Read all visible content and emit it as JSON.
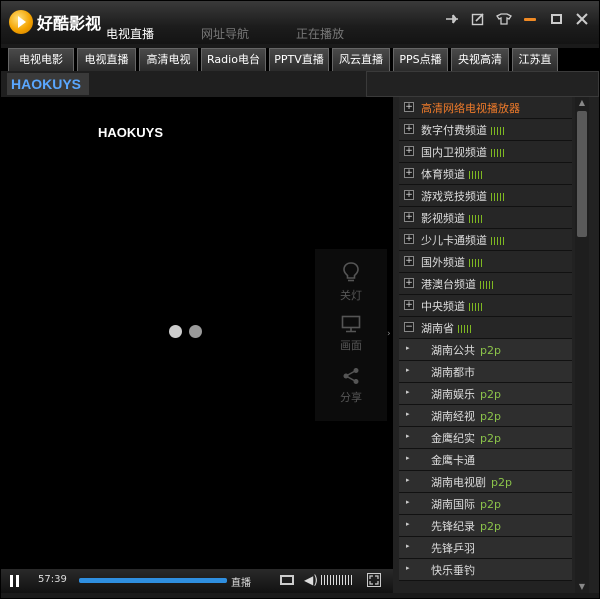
{
  "app": {
    "name": "好酷影视"
  },
  "top_nav": [
    {
      "label": "电视直播",
      "active": true
    },
    {
      "label": "网址导航",
      "active": false
    },
    {
      "label": "正在播放",
      "active": false
    }
  ],
  "tabs": [
    "电视电影",
    "电视直播",
    "高清电视",
    "Radio电台",
    "PPTV直播",
    "风云直播",
    "PPS点播",
    "央视高清",
    "江苏直"
  ],
  "brand": "HAOKUYS",
  "video_overlay_brand": "HAOKUYS",
  "tools": [
    {
      "icon": "bulb-icon",
      "label": "关灯"
    },
    {
      "icon": "monitor-icon",
      "label": "画面"
    },
    {
      "icon": "share-icon",
      "label": "分享"
    }
  ],
  "controls": {
    "time": "57:39",
    "progress_fraction": 1.0,
    "live_label": "直播"
  },
  "channels": [
    {
      "type": "cat",
      "label": "高清网络电视播放器",
      "orange": true,
      "sig": false
    },
    {
      "type": "cat",
      "label": "数字付费频道",
      "sig": true
    },
    {
      "type": "cat",
      "label": "国内卫视频道",
      "sig": true
    },
    {
      "type": "cat",
      "label": "体育频道",
      "sig": true
    },
    {
      "type": "cat",
      "label": "游戏竞技频道",
      "sig": true
    },
    {
      "type": "cat",
      "label": "影视频道",
      "sig": true
    },
    {
      "type": "cat",
      "label": "少儿卡通频道",
      "sig": true
    },
    {
      "type": "cat",
      "label": "国外频道",
      "sig": true
    },
    {
      "type": "cat",
      "label": "港澳台频道",
      "sig": true
    },
    {
      "type": "cat",
      "label": "中央频道",
      "sig": true
    },
    {
      "type": "cat",
      "label": "湖南省",
      "expanded": true,
      "sig": true
    },
    {
      "type": "sub",
      "label": "湖南公共",
      "tag": "p2p"
    },
    {
      "type": "sub",
      "label": "湖南都市",
      "tag": ""
    },
    {
      "type": "sub",
      "label": "湖南娱乐",
      "tag": "p2p"
    },
    {
      "type": "sub",
      "label": "湖南经视",
      "tag": "p2p"
    },
    {
      "type": "sub",
      "label": "金鹰纪实",
      "tag": "p2p"
    },
    {
      "type": "sub",
      "label": "金鹰卡通",
      "tag": ""
    },
    {
      "type": "sub",
      "label": "湖南电视剧",
      "tag": "p2p"
    },
    {
      "type": "sub",
      "label": "湖南国际",
      "tag": "p2p"
    },
    {
      "type": "sub",
      "label": "先锋纪录",
      "tag": "p2p"
    },
    {
      "type": "sub",
      "label": "先锋乒羽",
      "tag": ""
    },
    {
      "type": "sub",
      "label": "快乐垂钓",
      "tag": ""
    }
  ],
  "colors": {
    "brand_blue": "#5aa7ff",
    "accent_orange": "#f07b2a",
    "signal_green": "#7fb822",
    "p2p_green": "#8bc34a",
    "progress_blue": "#2f8fe0"
  }
}
